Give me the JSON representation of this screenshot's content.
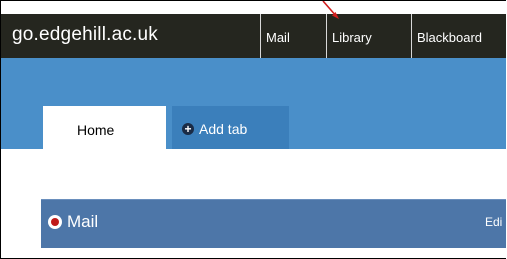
{
  "header": {
    "brand": "go.edgehill.ac.uk",
    "nav": [
      {
        "label": "Mail"
      },
      {
        "label": "Library"
      },
      {
        "label": "Blackboard"
      }
    ]
  },
  "tabs": {
    "home_label": "Home",
    "add_label": "Add tab",
    "add_symbol": "+"
  },
  "widget": {
    "title": "Mail",
    "edit_label": "Edi"
  },
  "colors": {
    "topbar": "#25261f",
    "band": "#4a8fc9",
    "widget_header": "#4d76a8",
    "pointer": "#d21f1f"
  }
}
